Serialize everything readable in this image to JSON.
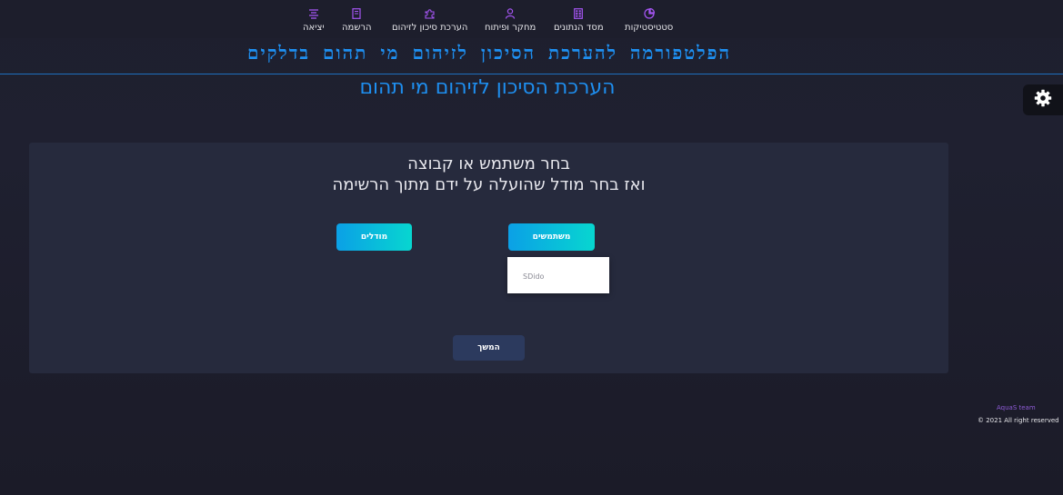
{
  "nav": {
    "items": [
      {
        "label": "סטטיסטיקות",
        "icon": "pie-chart-icon"
      },
      {
        "label": "מסד הנתונים",
        "icon": "grid-icon"
      },
      {
        "label": "מחקר ופיתוח",
        "icon": "user-icon"
      },
      {
        "label": "הערכת סיכון לזיהום",
        "icon": "puzzle-icon"
      },
      {
        "label": "הרשמה",
        "icon": "book-icon"
      },
      {
        "label": "יציאה",
        "icon": "menu-lines-icon"
      }
    ],
    "icon_color": "#a455f2"
  },
  "header": {
    "app_title": "הפלטפורמה להערכת הסיכון לזיהום מי תהום בדלקים",
    "page_title": "הערכת הסיכון לזיהום מי תהום"
  },
  "settings": {
    "icon": "gear-icon"
  },
  "card": {
    "instruction_line1": "בחר משתמש או קבוצה",
    "instruction_line2": "ואז בחר מודל שהועלה על ידם מתוך הרשימה",
    "models_button": "מודלים",
    "users_button": "משתמשים",
    "users_dropdown": {
      "options": [
        "SDido"
      ]
    },
    "continue_button": "המשך"
  },
  "footer": {
    "team": "AquaS team",
    "copyright": "© 2021 All right reserved"
  },
  "colors": {
    "accent_blue": "#1e8ff0",
    "button_gradient_start": "#0ba0e6",
    "button_gradient_end": "#07d6d0",
    "card_bg": "#262a3d",
    "page_bg": "#1c1c29",
    "footer_team": "#8e5bd6"
  }
}
